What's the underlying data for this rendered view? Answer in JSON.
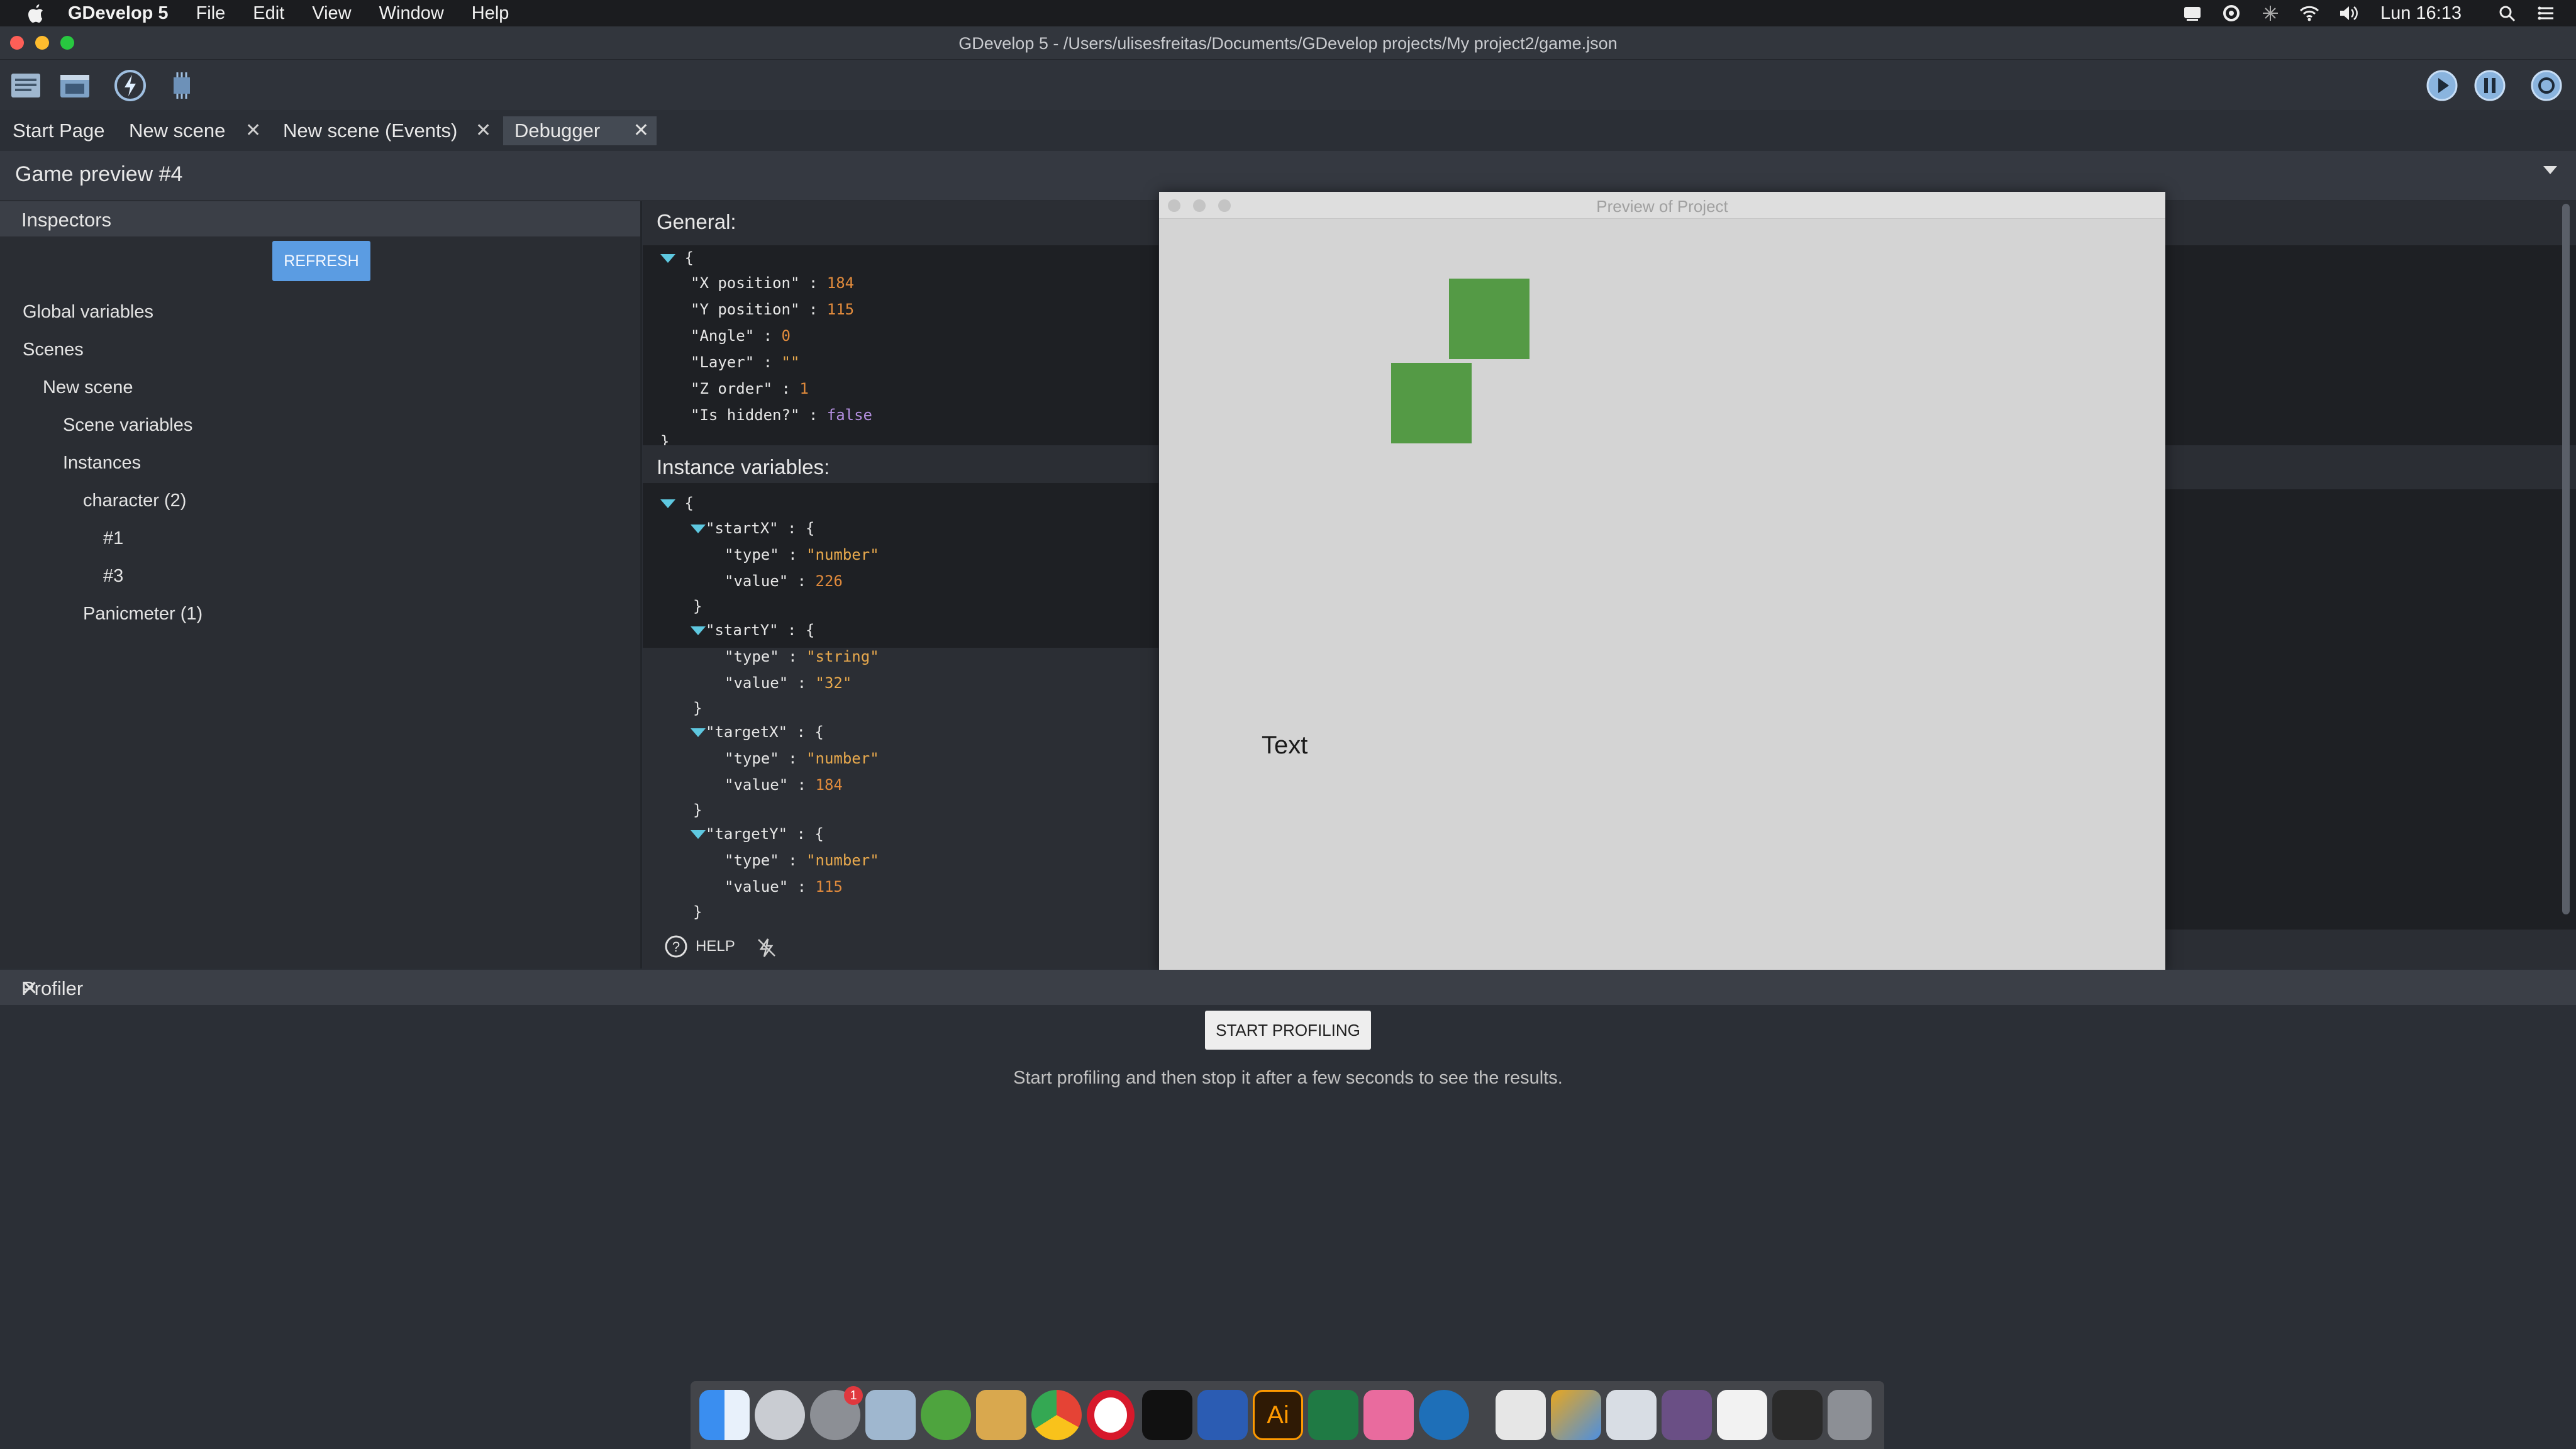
{
  "menubar": {
    "app": "GDevelop 5",
    "items": [
      "File",
      "Edit",
      "View",
      "Window",
      "Help"
    ],
    "clock": "Lun 16:13"
  },
  "window": {
    "title": "GDevelop 5 - /Users/ulisesfreitas/Documents/GDevelop projects/My project2/game.json"
  },
  "tabs": [
    {
      "label": "Start Page"
    },
    {
      "label": "New scene"
    },
    {
      "label": "New scene (Events)"
    },
    {
      "label": "Debugger"
    }
  ],
  "debugger": {
    "header": "Game preview #4"
  },
  "inspectors": {
    "title": "Inspectors",
    "refresh": "REFRESH",
    "tree": [
      {
        "label": "Global variables"
      },
      {
        "label": "Scenes"
      },
      {
        "label": "New scene"
      },
      {
        "label": "Scene variables"
      },
      {
        "label": "Instances"
      },
      {
        "label": "character (2)"
      },
      {
        "label": "#1"
      },
      {
        "label": "#3"
      },
      {
        "label": "Panicmeter (1)"
      }
    ]
  },
  "general": {
    "title": "General:",
    "rows": [
      {
        "key": "\"X position\"",
        "value": "184"
      },
      {
        "key": "\"Y position\"",
        "value": "115"
      },
      {
        "key": "\"Angle\"",
        "value": "0"
      },
      {
        "key": "\"Layer\"",
        "value": "\"\""
      },
      {
        "key": "\"Z order\"",
        "value": "1"
      },
      {
        "key": "\"Is hidden?\"",
        "value": "false"
      }
    ]
  },
  "instance_vars": {
    "title": "Instance variables:",
    "vars": [
      {
        "name": "\"startX\"",
        "type": "\"number\"",
        "value": "226"
      },
      {
        "name": "\"startY\"",
        "type": "\"string\"",
        "value": "\"32\""
      },
      {
        "name": "\"targetX\"",
        "type": "\"number\"",
        "value": "184"
      },
      {
        "name": "\"targetY\"",
        "type": "\"number\"",
        "value": "115"
      }
    ],
    "type_key": "\"type\"",
    "value_key": "\"value\""
  },
  "help": "HELP",
  "preview": {
    "title": "Preview of Project",
    "text": "Text"
  },
  "profiler": {
    "title": "Profiler",
    "button": "START PROFILING",
    "message": "Start profiling and then stop it after a few seconds to see the results."
  },
  "dock": {
    "badge": "1",
    "ai_label": "Ai"
  }
}
